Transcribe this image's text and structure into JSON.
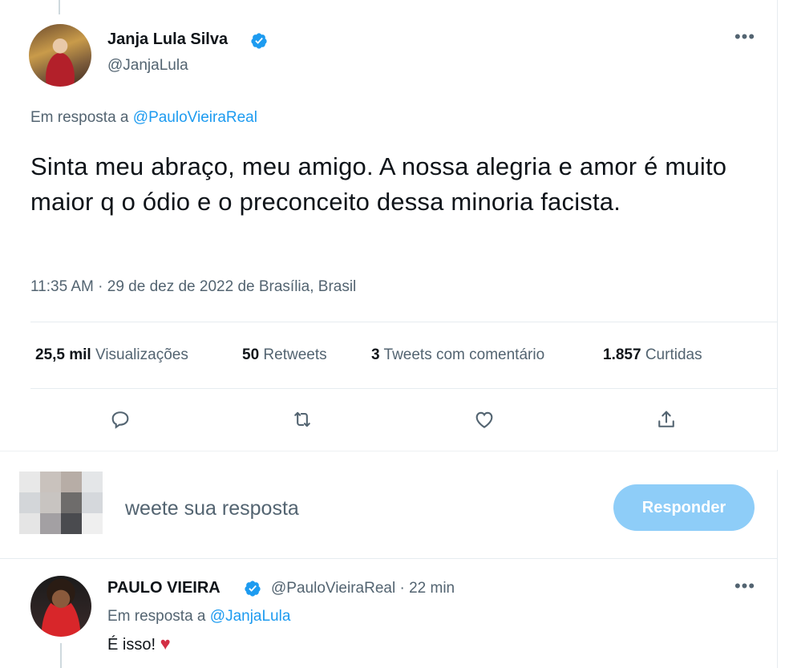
{
  "main_tweet": {
    "author_name": "Janja Lula Silva",
    "handle": "@JanjaLula",
    "more_label": "•••",
    "reply_prefix": "Em resposta a",
    "reply_handle": "@PauloVieiraReal",
    "text": "Sinta meu abraço, meu amigo. A nossa alegria e amor é muito maior q o ódio e o preconceito dessa minoria facista.",
    "timestamp": "11:35 AM · 29 de dez de 2022 de Brasília, Brasil",
    "stats": {
      "views_count": "25,5 mil",
      "views_label": "Visualizações",
      "retweets_count": "50",
      "retweets_label": "Retweets",
      "quotes_count": "3",
      "quotes_label": "Tweets com comentário",
      "likes_count": "1.857",
      "likes_label": "Curtidas"
    },
    "actions": [
      "reply-icon",
      "retweet-icon",
      "like-icon",
      "share-icon"
    ]
  },
  "compose": {
    "placeholder": "weete sua resposta",
    "button_label": "Responder"
  },
  "reply_tweet": {
    "author_name": "PAULO VIEIRA",
    "handle": "@PauloVieiraReal",
    "time": "· 22 min",
    "more_label": "•••",
    "reply_prefix": "Em resposta a",
    "reply_handle": "@JanjaLula",
    "text": "É isso!",
    "emoji": "♥"
  },
  "colors": {
    "verified": "#1d9bf0",
    "link": "#1d9bf0",
    "secondary_text": "#536471",
    "reply_button": "#8ecdf8",
    "heart": "#d32f45"
  }
}
